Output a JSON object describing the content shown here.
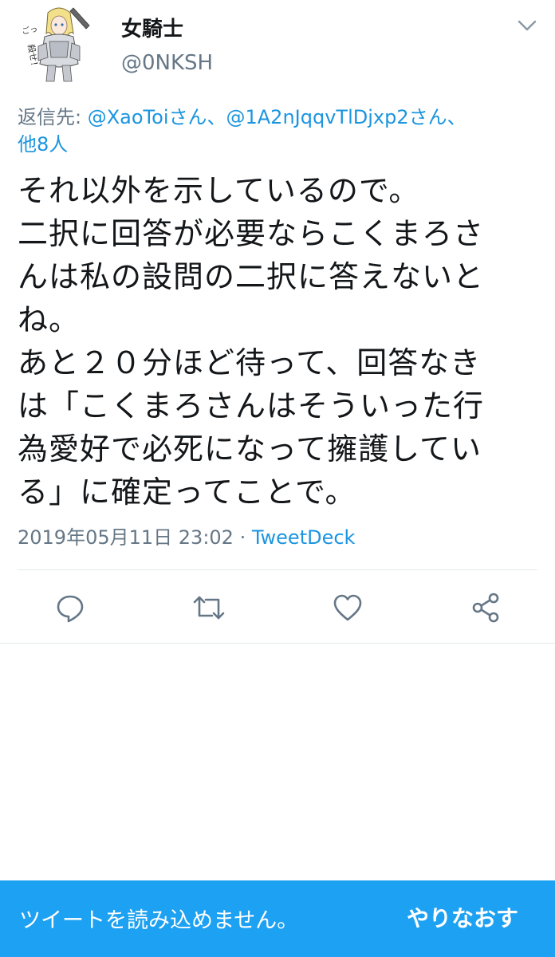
{
  "user": {
    "display_name": "女騎士",
    "handle": "@0NKSH",
    "avatar_caption": "ごっ 殺せ！"
  },
  "reply": {
    "prefix": "返信先: ",
    "mention1": "@XaoToiさん",
    "sep": "、",
    "mention2": "@1A2nJqqvTlDjxp2さん",
    "others": "他8人"
  },
  "tweet": {
    "lines": [
      "それ以外を示しているので。",
      "二択に回答が必要ならこくまろさ",
      "んは私の設問の二択に答えないと",
      "ね。",
      "あと２０分ほど待って、回答なき",
      "は「こくまろさんはそういった行",
      "為愛好で必死になって擁護してい",
      "る」に確定ってことで。"
    ]
  },
  "meta": {
    "timestamp": "2019年05月11日 23:02",
    "separator": " · ",
    "source": "TweetDeck"
  },
  "actions": [
    {
      "icon": "reply-icon"
    },
    {
      "icon": "retweet-icon"
    },
    {
      "icon": "like-icon"
    },
    {
      "icon": "share-icon"
    }
  ],
  "error_bar": {
    "message": "ツイートを読み込めません。",
    "retry_label": "やりなおす"
  },
  "colors": {
    "accent": "#1da1f2",
    "link": "#1b95e0",
    "secondary_text": "#657786",
    "icon": "#657786"
  }
}
